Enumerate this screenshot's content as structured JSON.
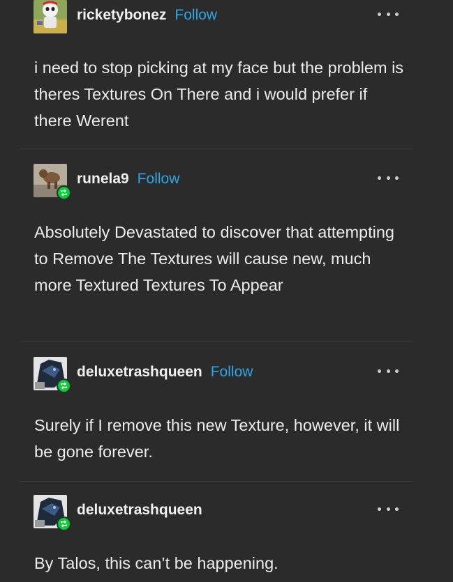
{
  "posts": [
    {
      "username": "ricketybonez",
      "follow_label": "Follow",
      "avatar_icon": "cartoon-skull-avatar",
      "reblogged": false,
      "text": "i need to stop picking at my face but the problem is theres Textures On There and i would prefer if there Werent"
    },
    {
      "username": "runela9",
      "follow_label": "Follow",
      "avatar_icon": "animal-photo-avatar",
      "reblogged": true,
      "text": "Absolutely Devastated to discover that attempting to Remove The Textures will cause new, much more Textured Textures To Appear"
    },
    {
      "username": "deluxetrashqueen",
      "follow_label": "Follow",
      "avatar_icon": "dark-creature-avatar",
      "reblogged": true,
      "text": "Surely if I remove this new Texture, however, it will be gone forever."
    },
    {
      "username": "deluxetrashqueen",
      "follow_label": "",
      "avatar_icon": "dark-creature-avatar",
      "reblogged": true,
      "text": "By Talos, this can’t be happening."
    }
  ],
  "icons": {
    "more": "more-options-icon",
    "reblog": "reblog-icon"
  },
  "colors": {
    "background": "#2b2b2b",
    "text": "#ececec",
    "follow": "#2ea8e5",
    "reblog_badge": "#00cf35",
    "divider": "#3f3f3f"
  }
}
